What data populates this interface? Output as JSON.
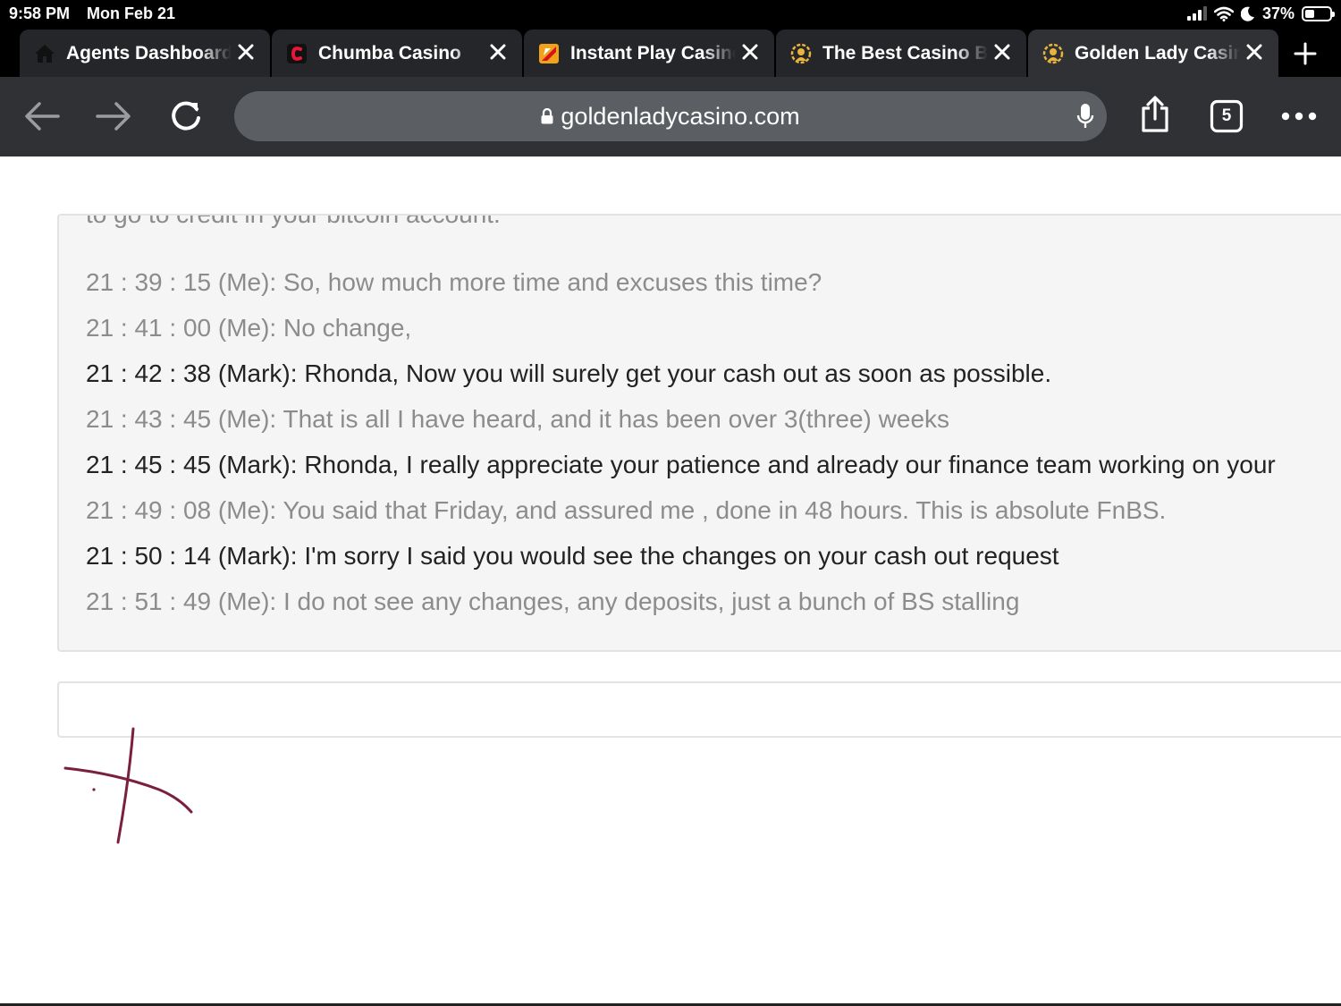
{
  "status_bar": {
    "time": "9:58 PM",
    "date": "Mon Feb 21",
    "battery": "37%",
    "battery_level": 0.37
  },
  "tabs": [
    {
      "title": "Agents Dashboard",
      "favicon": "home-icon"
    },
    {
      "title": "Chumba Casino",
      "favicon": "chumba-logo-icon"
    },
    {
      "title": "Instant Play Casino",
      "favicon": "instant-play-logo-icon"
    },
    {
      "title": "The Best Casino Bonus",
      "favicon": "golden-lady-logo-icon"
    },
    {
      "title": "Golden Lady Casino",
      "favicon": "golden-lady-logo-icon",
      "active": true
    }
  ],
  "toolbar": {
    "url": "goldenladycasino.com",
    "tab_count": "5"
  },
  "chat": {
    "cut_line": "to go to credit in your bitcoin account.",
    "messages": [
      {
        "text": "21 : 39 : 15 (Me): So, how much more time and excuses this time?",
        "sender": "me"
      },
      {
        "text": "21 : 41 : 00 (Me): No change,",
        "sender": "me"
      },
      {
        "text": "21 : 42 : 38 (Mark): Rhonda, Now you will surely get your cash out as soon as possible.",
        "sender": "agent"
      },
      {
        "text": "21 : 43 : 45 (Me): That is all I have heard, and it has been over 3(three) weeks",
        "sender": "me"
      },
      {
        "text": "21 : 45 : 45 (Mark): Rhonda, I really appreciate your patience and already our finance team working on your",
        "sender": "agent"
      },
      {
        "text": "21 : 49 : 08 (Me): You said that Friday, and assured me , done in 48 hours. This is absolute FnBS.",
        "sender": "me"
      },
      {
        "text": "21 : 50 : 14 (Mark): I'm sorry I said you would see the changes on your cash out request",
        "sender": "agent"
      },
      {
        "text": "21 : 51 : 49 (Me): I do not see any changes, any deposits, just a bunch of BS stalling",
        "sender": "me"
      }
    ]
  },
  "colors": {
    "chrome_dark": "#2f3134",
    "doodle": "#7a1f3d",
    "me_text": "#8c8c8c",
    "agent_text": "#222222"
  }
}
